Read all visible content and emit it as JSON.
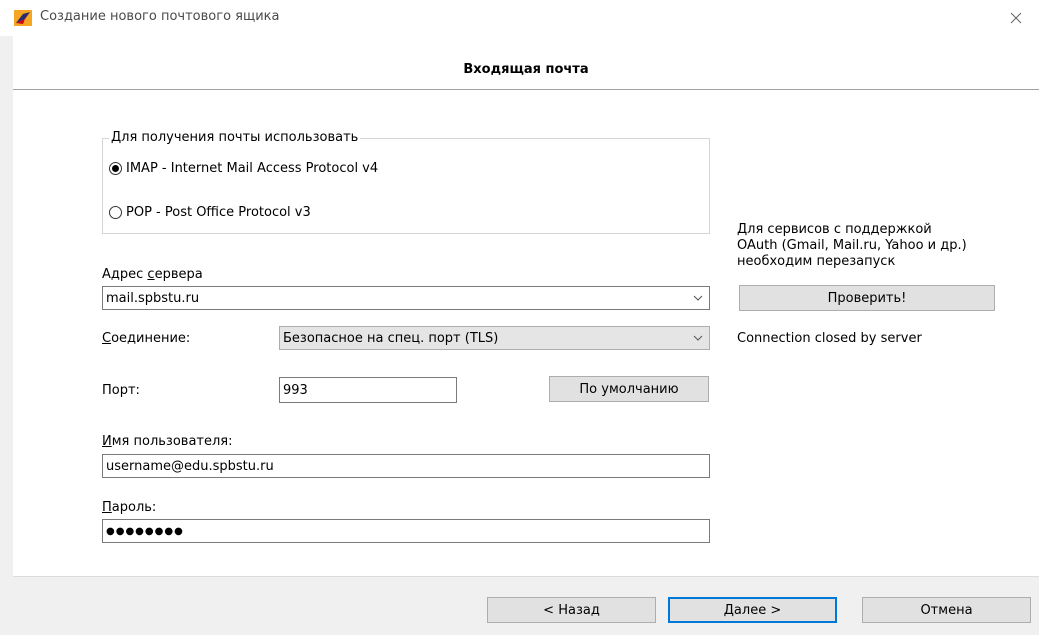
{
  "window": {
    "title": "Создание нового почтового ящика",
    "close_glyph": "✕"
  },
  "section": {
    "title": "Входящая почта"
  },
  "protocol_group": {
    "legend": "Для получения почты использовать",
    "options": [
      {
        "label": "IMAP - Internet Mail Access Protocol v4",
        "selected": true
      },
      {
        "label": "POP  -  Post Office Protocol v3",
        "selected": false
      }
    ]
  },
  "server": {
    "label_prefix": "Адрес ",
    "label_accel": "с",
    "label_rest": "ервера",
    "value": "mail.spbstu.ru"
  },
  "connection": {
    "label_accel": "С",
    "label_rest": "оединение:",
    "value": "Безопасное на спец. порт (TLS)"
  },
  "port": {
    "label": "Порт:",
    "value": "993",
    "default_button": "По умолчанию"
  },
  "username": {
    "label_accel": "И",
    "label_rest": "мя пользователя:",
    "value": "username@edu.spbstu.ru"
  },
  "password": {
    "label_accel": "П",
    "label_rest": "ароль:",
    "value": "●●●●●●●●"
  },
  "oauth": {
    "note_line1": "Для сервисов с поддержкой",
    "note_line2": "OAuth (Gmail, Mail.ru, Yahoo и др.)",
    "note_line3": "необходим перезапуск",
    "check_button": "Проверить!",
    "status": "Connection closed by server"
  },
  "footer": {
    "back_button": "< Назад",
    "next_accel": "Д",
    "next_rest": "алее  >",
    "cancel_button": "Отмена"
  },
  "colors": {
    "accent_blue": "#0078d7",
    "button_gray": "#e1e1e1",
    "window_bg": "#f0f0f0"
  }
}
